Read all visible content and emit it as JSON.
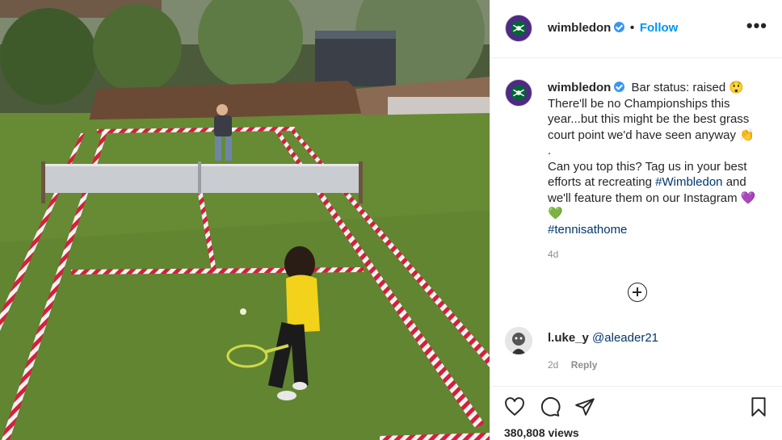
{
  "header": {
    "username": "wimbledon",
    "separator": "•",
    "follow_label": "Follow",
    "more_label": "•••"
  },
  "caption": {
    "username": "wimbledon",
    "line1": "Bar status: raised 😲",
    "line2": "There'll be no Championships this year...but this might be the best grass court point we'd have seen anyway 👏",
    "line3": ".",
    "line4": "Can you top this? Tag us in your best efforts at recreating",
    "hashtag1": "#Wimbledon",
    "line5": "and we'll feature them on our Instagram 💜💚",
    "hashtag2": "#tennisathome",
    "age": "4d"
  },
  "comment": {
    "username": "l.uke_y",
    "mention": "@aleader21",
    "age": "2d",
    "reply_label": "Reply"
  },
  "footer": {
    "views": "380,808 views"
  },
  "icons": [
    "wimbledon-logo-icon",
    "verified-badge-icon",
    "more-options-icon",
    "load-more-comments-icon",
    "like-heart-icon",
    "comment-bubble-icon",
    "share-plane-icon",
    "save-bookmark-icon"
  ],
  "colors": {
    "accent": "#0095f6",
    "verified": "#3897f0",
    "wimbledon_purple": "#4e2a84",
    "wimbledon_green": "#006633",
    "text": "#262626",
    "muted": "#8e8e8e",
    "link": "#00376b"
  }
}
